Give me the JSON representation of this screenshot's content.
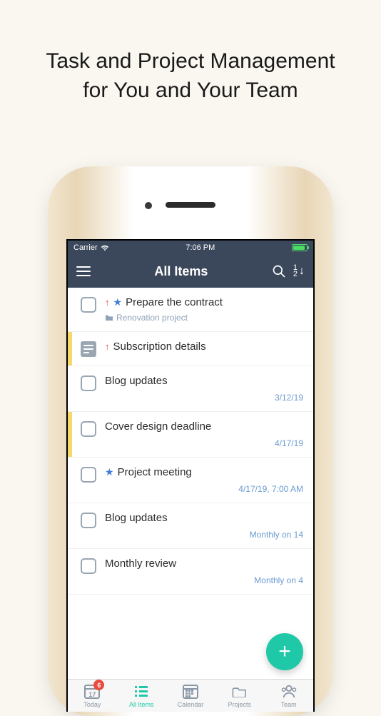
{
  "promo": {
    "line1": "Task and Project Management",
    "line2": "for You and Your Team"
  },
  "status_bar": {
    "carrier": "Carrier",
    "time": "7:06 PM"
  },
  "nav": {
    "title": "All Items",
    "sort_top": "1",
    "sort_bottom": "2"
  },
  "tasks": [
    {
      "kind": "task",
      "stripe": null,
      "priority": true,
      "star": true,
      "title": "Prepare the contract",
      "project": "Renovation project",
      "date": null
    },
    {
      "kind": "note",
      "stripe": "yellow",
      "priority": true,
      "star": false,
      "title": "Subscription details",
      "project": null,
      "date": null
    },
    {
      "kind": "task",
      "stripe": null,
      "priority": false,
      "star": false,
      "title": "Blog updates",
      "project": null,
      "date": "3/12/19"
    },
    {
      "kind": "task",
      "stripe": "yellow",
      "priority": false,
      "star": false,
      "title": "Cover design deadline",
      "project": null,
      "date": "4/17/19"
    },
    {
      "kind": "task",
      "stripe": null,
      "priority": false,
      "star": true,
      "title": "Project meeting",
      "project": null,
      "date": "4/17/19, 7:00 AM"
    },
    {
      "kind": "task",
      "stripe": null,
      "priority": false,
      "star": false,
      "title": "Blog updates",
      "project": null,
      "date": "Monthly on 14"
    },
    {
      "kind": "task",
      "stripe": null,
      "priority": false,
      "star": false,
      "title": "Monthly review",
      "project": null,
      "date": "Monthly on 4"
    }
  ],
  "fab": {
    "label": "+"
  },
  "tabs": {
    "today": {
      "label": "Today",
      "day": "17",
      "badge": "6"
    },
    "all_items": {
      "label": "All Items"
    },
    "calendar": {
      "label": "Calendar"
    },
    "projects": {
      "label": "Projects"
    },
    "team": {
      "label": "Team"
    }
  }
}
